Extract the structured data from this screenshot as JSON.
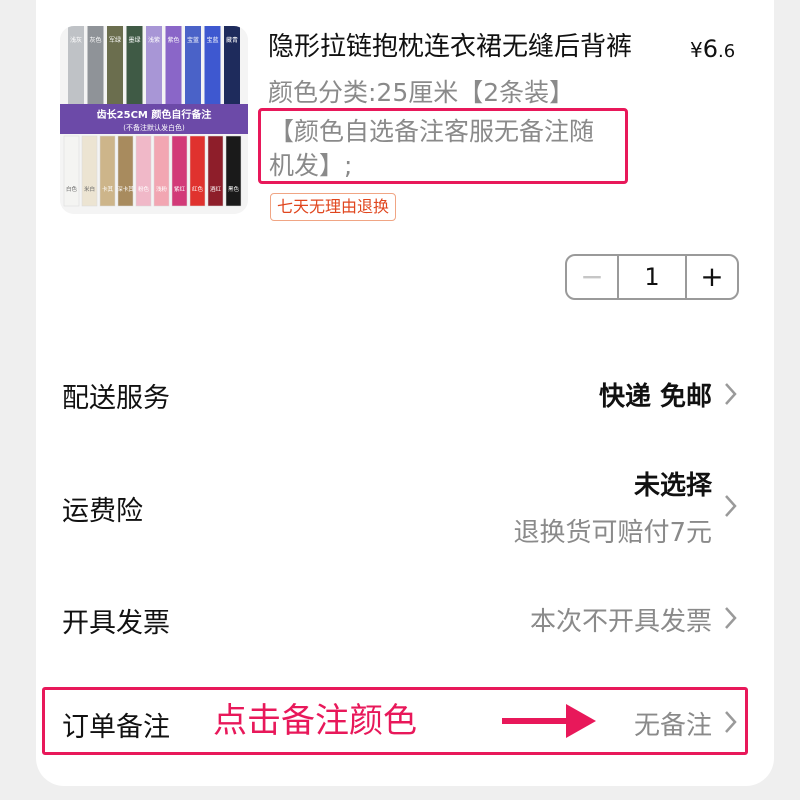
{
  "product": {
    "title": "隐形拉链抱枕连衣裙无缝后背裤",
    "price_symbol": "¥",
    "price_int": "6",
    "price_dec": ".6",
    "sku_line1": "颜色分类:25厘米【2条装】",
    "sku_line2": "【颜色自选备注客服无备注随",
    "sku_line3": "机发】;",
    "tag": "七天无理由退换",
    "image": {
      "banner_line1": "齿长25CM 颜色自行备注",
      "banner_line2": "(不备注默认发白色)",
      "top_labels": [
        "浅灰",
        "灰色",
        "军绿",
        "墨绿",
        "浅紫",
        "紫色",
        "宝蓝",
        "宝蓝",
        "藏青"
      ],
      "bottom_labels": [
        "白色",
        "米白",
        "卡其",
        "深卡其",
        "粉色",
        "浅粉",
        "紫红",
        "红色",
        "酒红",
        "黑色"
      ]
    }
  },
  "quantity": {
    "minus": "−",
    "value": "1",
    "plus": "+"
  },
  "rows": {
    "delivery": {
      "label": "配送服务",
      "value": "快递 免邮"
    },
    "insurance": {
      "label": "运费险",
      "value": "未选择",
      "sub": "退换货可赔付7元"
    },
    "invoice": {
      "label": "开具发票",
      "value": "本次不开具发票"
    },
    "remark": {
      "label": "订单备注",
      "value": "无备注"
    }
  },
  "annotation": {
    "text": "点击备注颜色",
    "color": "#e8185a"
  }
}
